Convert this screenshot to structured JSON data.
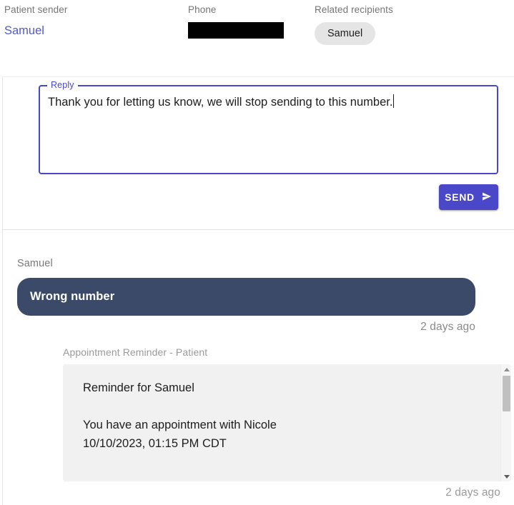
{
  "header": {
    "sender_label": "Patient sender",
    "sender_name": "Samuel",
    "phone_label": "Phone",
    "phone_value": "",
    "recipients_label": "Related recipients",
    "recipient_chip": "Samuel"
  },
  "reply": {
    "field_label": "Reply",
    "value": "Thank you for letting us know, we will stop sending to this number.",
    "send_label": "SEND",
    "send_icon": "send-icon",
    "accent_color": "#4a47c9"
  },
  "thread": {
    "incoming": {
      "author": "Samuel",
      "text": "Wrong number",
      "timestamp": "2 days ago",
      "bubble_color": "#3b4a68"
    },
    "reminder": {
      "title": "Appointment Reminder - Patient",
      "body": "Reminder for Samuel\n\nYou have an appointment with Nicole\n10/10/2023, 01:15 PM CDT",
      "timestamp": "2 days ago",
      "scroll_up_icon": "caret-up-icon",
      "scroll_down_icon": "caret-down-icon"
    }
  }
}
